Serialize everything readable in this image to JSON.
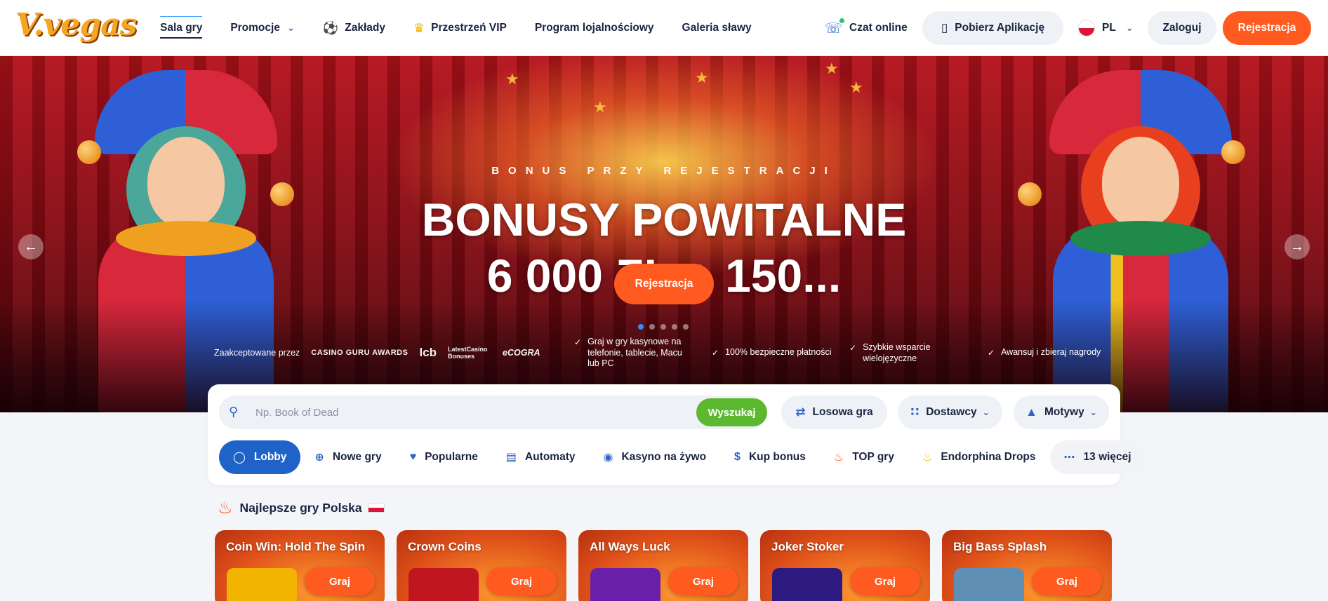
{
  "brand": {
    "logo_text": "V.vegas"
  },
  "nav": {
    "items": [
      {
        "label": "Sala gry",
        "icon": ""
      },
      {
        "label": "Promocje",
        "icon": "chevron-down-icon"
      },
      {
        "label": "Zakłady",
        "icon": "soccer-ball-icon"
      },
      {
        "label": "Przestrzeń VIP",
        "icon": "crown-icon"
      },
      {
        "label": "Program lojalnościowy",
        "icon": ""
      },
      {
        "label": "Galeria sławy",
        "icon": ""
      }
    ],
    "chat_label": "Czat online",
    "app_label": "Pobierz Aplikację",
    "lang_label": "PL",
    "login_label": "Zaloguj",
    "register_label": "Rejestracja"
  },
  "hero": {
    "subtitle": "BONUS PRZY REJESTRACJI",
    "title_line1": "BONUSY POWITALNE",
    "title_line2": "6 000 ZŁ + 150...",
    "cta_label": "Rejestracja",
    "slides_total": 5,
    "slide_active": 1,
    "accepted_label": "Zaakceptowane przez",
    "partners": [
      "CASINO GURU AWARDS",
      "lcb",
      "LatestCasino Bonuses",
      "eCOGRA"
    ],
    "features": [
      "Graj w gry kasynowe na telefonie, tablecie, Macu lub PC",
      "100% bezpieczne płatności",
      "Szybkie wsparcie wielojęzyczne",
      "Awansuj i zbieraj nagrody"
    ]
  },
  "search": {
    "placeholder": "Np. Book of Dead",
    "button_label": "Wyszukaj",
    "random_label": "Losowa gra",
    "providers_label": "Dostawcy",
    "themes_label": "Motywy"
  },
  "categories": [
    {
      "label": "Lobby",
      "icon": "medal-icon"
    },
    {
      "label": "Nowe gry",
      "icon": "plus-circle-icon"
    },
    {
      "label": "Popularne",
      "icon": "heart-icon"
    },
    {
      "label": "Automaty",
      "icon": "slot-machine-icon"
    },
    {
      "label": "Kasyno na żywo",
      "icon": "live-icon"
    },
    {
      "label": "Kup bonus",
      "icon": "dollar-icon"
    },
    {
      "label": "TOP gry",
      "icon": "fire-icon"
    },
    {
      "label": "Endorphina Drops",
      "icon": "flame-icon"
    },
    {
      "label": "13 więcej",
      "icon": "more-dots-icon"
    }
  ],
  "section": {
    "title": "Najlepsze gry Polska"
  },
  "games": [
    {
      "title": "Coin Win: Hold The Spin",
      "play_label": "Graj",
      "thumb_color": "#f2b400"
    },
    {
      "title": "Crown Coins",
      "play_label": "Graj",
      "thumb_color": "#c0161f"
    },
    {
      "title": "All Ways Luck",
      "play_label": "Graj",
      "thumb_color": "#6a1fa8"
    },
    {
      "title": "Joker Stoker",
      "play_label": "Graj",
      "thumb_color": "#2d1a80"
    },
    {
      "title": "Big Bass Splash",
      "play_label": "Graj",
      "thumb_color": "#5f8fb5"
    }
  ],
  "colors": {
    "accent": "#ff5a1f",
    "primary_blue": "#1f63c9",
    "search_green": "#5cb82e"
  }
}
